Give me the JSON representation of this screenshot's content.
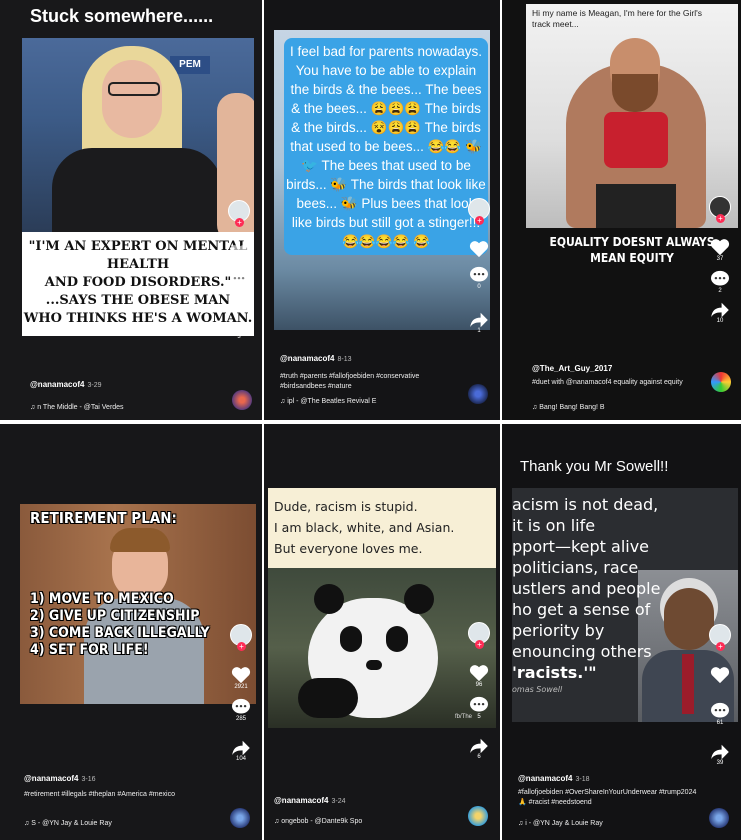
{
  "tiles": [
    {
      "top_caption": "Stuck somewhere......",
      "meme_lines": [
        "\"I'M AN EXPERT ON MENTAL HEALTH",
        "AND FOOD DISORDERS.\"",
        "...SAYS THE OBESE MAN",
        "WHO THINKS HE'S A WOMAN."
      ],
      "sign_text": "PEM",
      "share_count": "3",
      "author": "@nanamacof4",
      "date": "3-29",
      "sound": "n The Middle - @Tai Verdes"
    },
    {
      "bubble_text": "I feel bad for parents nowadays. You have to be able to explain the birds & the bees... The bees & the bees... 😩😩😩 The birds & the birds... 😵😩😩 The birds that used to be bees... 😂😂 🐝🐦 The bees that used to be birds... 🐝 The birds that look like bees... 🐝 Plus bees that look like birds but still got a stinger!!! 😂😂😂😂 😂",
      "comment_count": "0",
      "share_count": "1",
      "author": "@nanamacof4",
      "date": "8-13",
      "tags": "#truth #parents #fallofjoebiden #conservative #birdsandbees #nature",
      "sound": "ipl - @The Beatles Revival E"
    },
    {
      "top_caption": "Hi my name is Meagan, I'm here for the Girl's track meet...",
      "meme_lines": [
        "EQUALITY DOESNT ALWAYS",
        "MEAN EQUITY"
      ],
      "like_count": "37",
      "comment_count": "2",
      "share_count": "10",
      "author": "@The_Art_Guy_2017",
      "tags": "#duet with @nanamacof4 equality against equity",
      "sound": "Bang!  Bang!  Bang!  B"
    },
    {
      "meme_lines": [
        "RETIREMENT PLAN:",
        "1) MOVE TO MEXICO",
        "2) GIVE UP CITIZENSHIP",
        "3) COME BACK ILLEGALLY",
        "4) SET FOR LIFE!"
      ],
      "like_count": "2921",
      "comment_count": "285",
      "share_count": "104",
      "author": "@nanamacof4",
      "date": "3-16",
      "tags": "#retirement #illegals #theplan #America #mexico",
      "sound": "S - @YN Jay & Louie Ray"
    },
    {
      "meme_lines": [
        "Dude, racism is stupid.",
        "I am black, white, and Asian.",
        "But everyone loves me."
      ],
      "like_count": "96",
      "comment_count": "5",
      "share_count": "6",
      "author": "@nanamacof4",
      "date": "3-24",
      "watermark": "fb/The",
      "sound": "ongebob - @Dante9k   Spo"
    },
    {
      "top_caption": "Thank you Mr Sowell!!",
      "quote_lines": [
        "acism is not dead,",
        "it is on life",
        "pport—kept alive",
        "politicians, race",
        "ustlers and people",
        "ho get a sense of",
        "periority by",
        "enouncing others",
        "'racists.'\""
      ],
      "attribution": "omas Sowell",
      "comment_count": "61",
      "share_count": "39",
      "author": "@nanamacof4",
      "date": "3-18",
      "tags": "#fallofjoebiden #OverShareInYourUnderwear #trump2024 🙏 #racist #needstoend",
      "sound": "i - @YN Jay & Louie Ray"
    }
  ]
}
